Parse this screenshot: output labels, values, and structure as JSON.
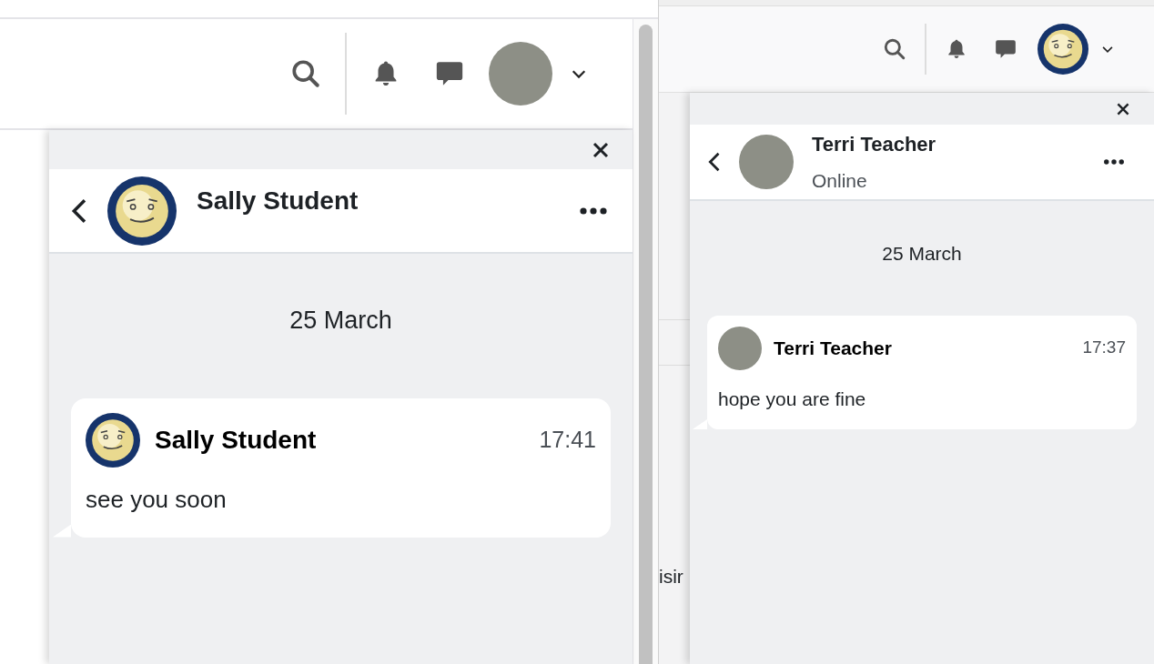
{
  "windows": [
    {
      "user_avatar": {
        "kind": "photo"
      },
      "chat": {
        "contact": {
          "name": "Sally Student",
          "avatar": {
            "kind": "smiley"
          }
        },
        "date": "25 March",
        "messages": [
          {
            "sender": "Sally Student",
            "time": "17:41",
            "text": "see you soon",
            "avatar": {
              "kind": "smiley"
            }
          }
        ]
      }
    },
    {
      "user_avatar": {
        "kind": "smiley"
      },
      "background_text": "isir",
      "chat": {
        "contact": {
          "name": "Terri Teacher",
          "status": "Online",
          "avatar": {
            "kind": "photo"
          }
        },
        "date": "25 March",
        "messages": [
          {
            "sender": "Terri Teacher",
            "time": "17:37",
            "text": "hope you are fine",
            "avatar": {
              "kind": "photo"
            }
          }
        ]
      }
    }
  ]
}
